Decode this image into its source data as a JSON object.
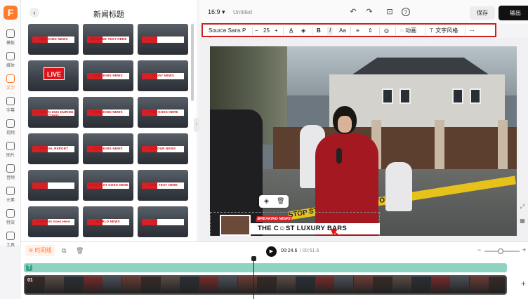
{
  "app": {
    "logo_letter": "F"
  },
  "rail": {
    "items": [
      {
        "label": "模板"
      },
      {
        "label": "媒体"
      },
      {
        "label": "文字"
      },
      {
        "label": "字幕"
      },
      {
        "label": "视频"
      },
      {
        "label": "图片"
      },
      {
        "label": "音频"
      },
      {
        "label": "元素"
      },
      {
        "label": "特效"
      },
      {
        "label": "工具"
      }
    ],
    "active_index": 2
  },
  "panel": {
    "back_icon": "chevron-left-icon",
    "title": "新闻标题",
    "templates": [
      {
        "text": "BREAKING NEWS",
        "style": "bar"
      },
      {
        "text": "HEADLINE TEXT HERE",
        "style": "bar"
      },
      {
        "text": "",
        "style": "bar"
      },
      {
        "text": "LIVE",
        "style": "live"
      },
      {
        "text": "BREAKING NEWS",
        "style": "bar"
      },
      {
        "text": "TODAY NEWS",
        "style": "bar"
      },
      {
        "text": "VOTING IN 2022 DURING COVID",
        "style": "bar"
      },
      {
        "text": "BREAKING NEWS",
        "style": "bar"
      },
      {
        "text": "TITLE GOES HERE",
        "style": "bar"
      },
      {
        "text": "SPECIAL REPORT",
        "style": "bar"
      },
      {
        "text": "BREAKING NEWS",
        "style": "bar"
      },
      {
        "text": "24 HOUR NEWS",
        "style": "bar"
      },
      {
        "text": "",
        "style": "bar"
      },
      {
        "text": "YOUR TEXT GOES HERE",
        "style": "bar"
      },
      {
        "text": "TITLE TEXT HERE",
        "style": "bar"
      },
      {
        "text": "Your Text Goes Here",
        "style": "bar"
      },
      {
        "text": "WORLD NEWS",
        "style": "bar"
      },
      {
        "text": "",
        "style": "bar"
      }
    ]
  },
  "topbar": {
    "aspect_ratio": "16:9",
    "doc_title": "Untitled",
    "save_label": "保存",
    "export_label": "输出"
  },
  "format_toolbar": {
    "font_family": "Source Sans P",
    "minus": "−",
    "font_size": "25",
    "plus": "+",
    "bold": "B",
    "italic": "I",
    "case": "Aa",
    "animation_label": "动画",
    "text_style_label": "文字风格"
  },
  "canvas": {
    "tape_text": "STOP STOP STOP STOP STOP",
    "lower_third": {
      "tag": "BREAKING NEWS",
      "headline": "THE C☺ST LUXURY BARS"
    }
  },
  "timeline": {
    "tab_label": "时间线",
    "current_time": "00:24.6",
    "total_time": "/ 00:51.6",
    "track_number": "01"
  },
  "colors": {
    "accent": "#ff7a2b",
    "highlight_box": "#d01f1f",
    "news_red": "#d71f26",
    "text_track": "#8ed3c2"
  }
}
